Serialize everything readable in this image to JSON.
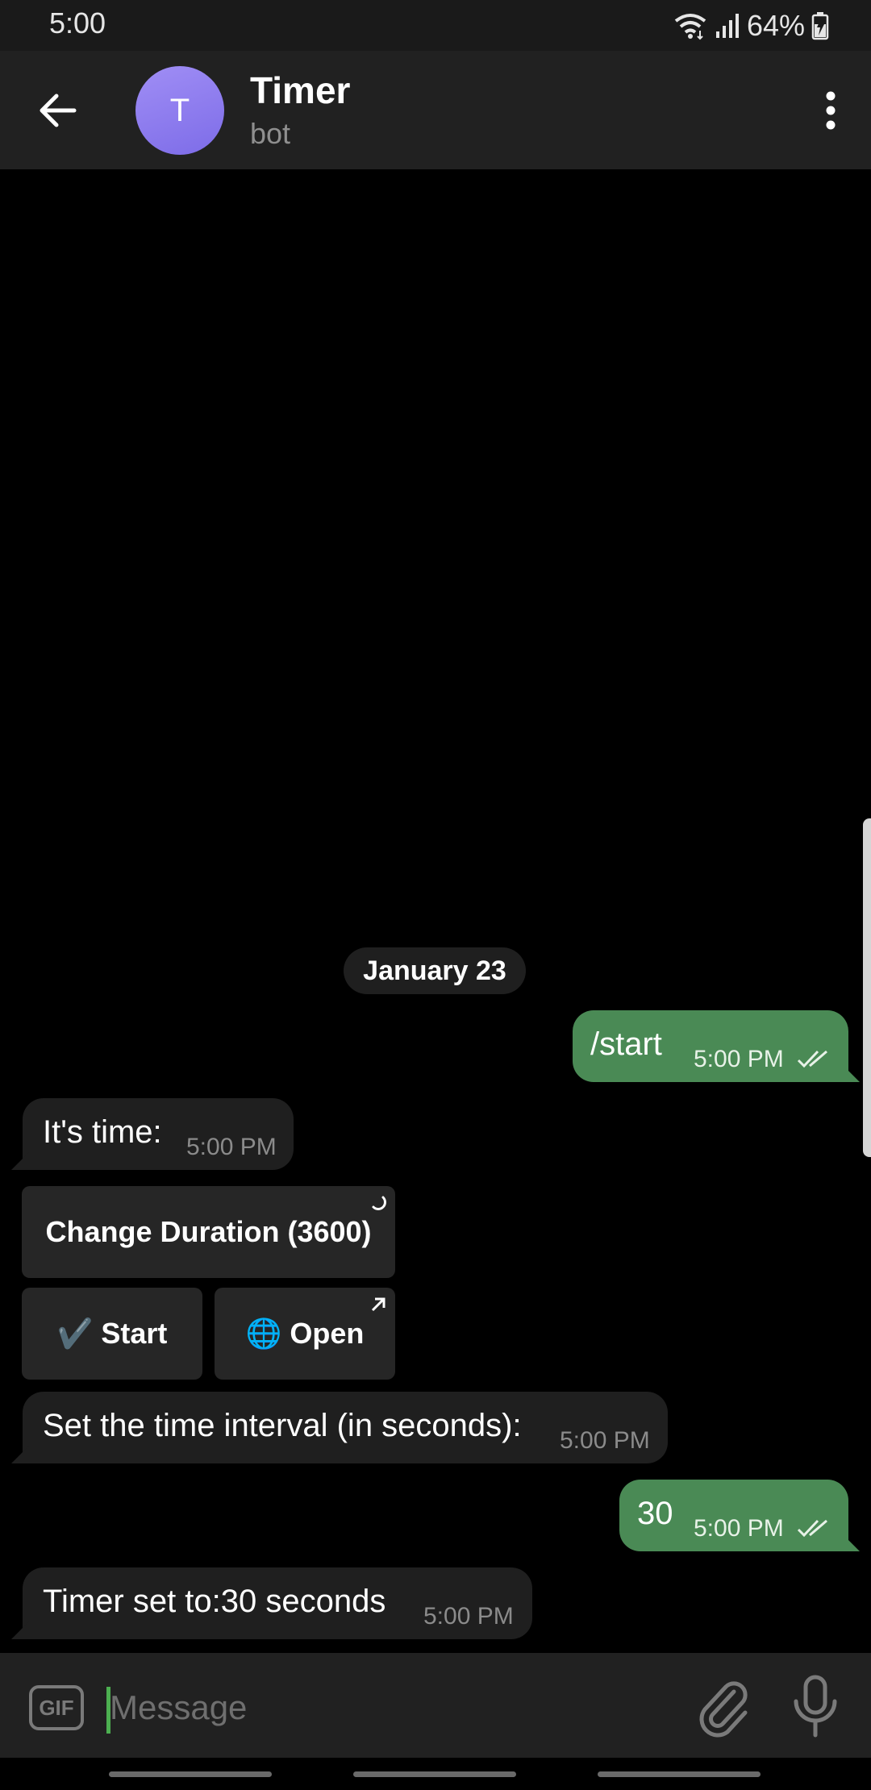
{
  "status_bar": {
    "time": "5:00",
    "battery": "64%"
  },
  "header": {
    "avatar_letter": "T",
    "title": "Timer",
    "subtitle": "bot"
  },
  "chat": {
    "date_label": "January 23",
    "messages": [
      {
        "direction": "outgoing",
        "text": "/start",
        "time": "5:00 PM",
        "read": true
      },
      {
        "direction": "incoming",
        "text": "It's time:",
        "time": "5:00 PM"
      },
      {
        "direction": "incoming",
        "text": "Set the time interval (in seconds):",
        "time": "5:00 PM"
      },
      {
        "direction": "outgoing",
        "text": "30",
        "time": "5:00 PM",
        "read": true
      },
      {
        "direction": "incoming",
        "text": "Timer set to:30 seconds",
        "time": "5:00 PM"
      }
    ],
    "keyboard": {
      "change_duration": "Change Duration (3600)",
      "start": "✔️ Start",
      "open": "🌐 Open"
    }
  },
  "input": {
    "placeholder": "Message",
    "gif_label": "GIF"
  },
  "colors": {
    "outgoing_bubble": "#4a8a55",
    "incoming_bubble": "#1f1f1f",
    "avatar": "#8a7af0",
    "cursor": "#4caf50"
  },
  "icons": {
    "back": "arrow-left-icon",
    "menu": "more-vertical-icon",
    "read": "double-check-icon",
    "attach": "paperclip-icon",
    "mic": "microphone-icon",
    "wifi": "wifi-icon",
    "signal": "signal-icon",
    "battery": "battery-icon"
  }
}
